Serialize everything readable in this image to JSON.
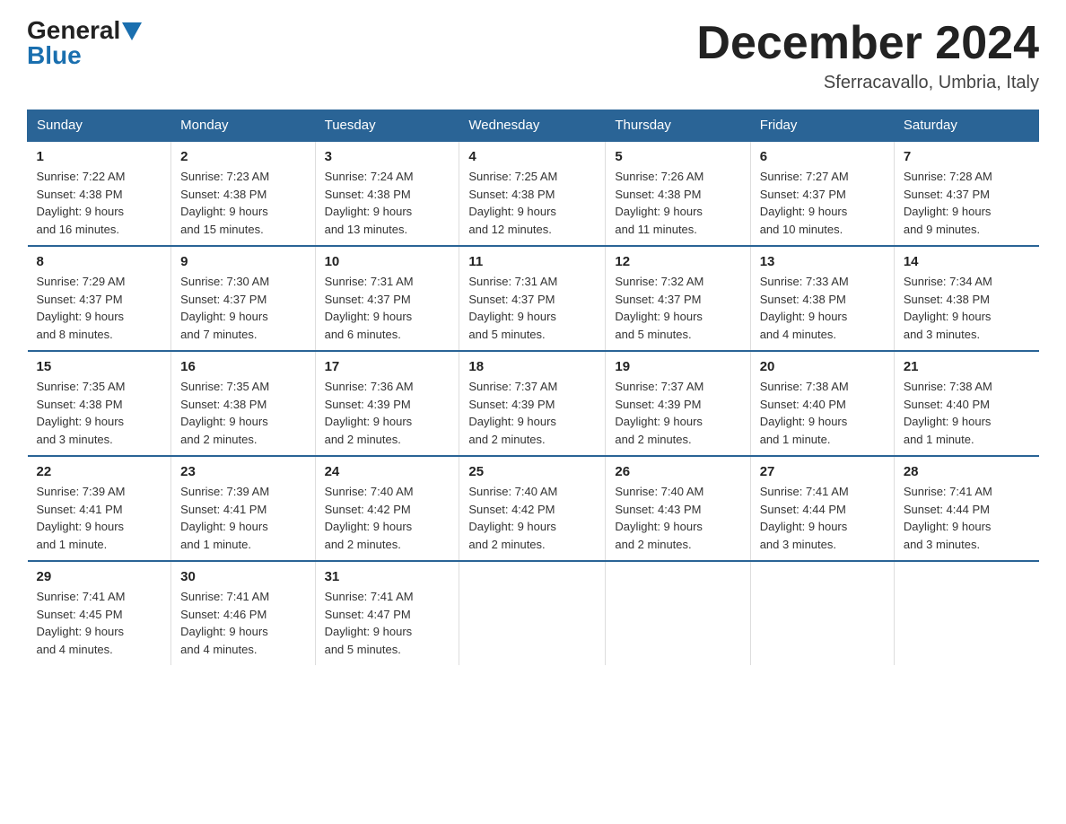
{
  "logo": {
    "general": "General",
    "blue": "Blue"
  },
  "header": {
    "month": "December 2024",
    "location": "Sferracavallo, Umbria, Italy"
  },
  "days_of_week": [
    "Sunday",
    "Monday",
    "Tuesday",
    "Wednesday",
    "Thursday",
    "Friday",
    "Saturday"
  ],
  "weeks": [
    [
      {
        "day": "1",
        "sunrise": "7:22 AM",
        "sunset": "4:38 PM",
        "daylight": "9 hours and 16 minutes."
      },
      {
        "day": "2",
        "sunrise": "7:23 AM",
        "sunset": "4:38 PM",
        "daylight": "9 hours and 15 minutes."
      },
      {
        "day": "3",
        "sunrise": "7:24 AM",
        "sunset": "4:38 PM",
        "daylight": "9 hours and 13 minutes."
      },
      {
        "day": "4",
        "sunrise": "7:25 AM",
        "sunset": "4:38 PM",
        "daylight": "9 hours and 12 minutes."
      },
      {
        "day": "5",
        "sunrise": "7:26 AM",
        "sunset": "4:38 PM",
        "daylight": "9 hours and 11 minutes."
      },
      {
        "day": "6",
        "sunrise": "7:27 AM",
        "sunset": "4:37 PM",
        "daylight": "9 hours and 10 minutes."
      },
      {
        "day": "7",
        "sunrise": "7:28 AM",
        "sunset": "4:37 PM",
        "daylight": "9 hours and 9 minutes."
      }
    ],
    [
      {
        "day": "8",
        "sunrise": "7:29 AM",
        "sunset": "4:37 PM",
        "daylight": "9 hours and 8 minutes."
      },
      {
        "day": "9",
        "sunrise": "7:30 AM",
        "sunset": "4:37 PM",
        "daylight": "9 hours and 7 minutes."
      },
      {
        "day": "10",
        "sunrise": "7:31 AM",
        "sunset": "4:37 PM",
        "daylight": "9 hours and 6 minutes."
      },
      {
        "day": "11",
        "sunrise": "7:31 AM",
        "sunset": "4:37 PM",
        "daylight": "9 hours and 5 minutes."
      },
      {
        "day": "12",
        "sunrise": "7:32 AM",
        "sunset": "4:37 PM",
        "daylight": "9 hours and 5 minutes."
      },
      {
        "day": "13",
        "sunrise": "7:33 AM",
        "sunset": "4:38 PM",
        "daylight": "9 hours and 4 minutes."
      },
      {
        "day": "14",
        "sunrise": "7:34 AM",
        "sunset": "4:38 PM",
        "daylight": "9 hours and 3 minutes."
      }
    ],
    [
      {
        "day": "15",
        "sunrise": "7:35 AM",
        "sunset": "4:38 PM",
        "daylight": "9 hours and 3 minutes."
      },
      {
        "day": "16",
        "sunrise": "7:35 AM",
        "sunset": "4:38 PM",
        "daylight": "9 hours and 2 minutes."
      },
      {
        "day": "17",
        "sunrise": "7:36 AM",
        "sunset": "4:39 PM",
        "daylight": "9 hours and 2 minutes."
      },
      {
        "day": "18",
        "sunrise": "7:37 AM",
        "sunset": "4:39 PM",
        "daylight": "9 hours and 2 minutes."
      },
      {
        "day": "19",
        "sunrise": "7:37 AM",
        "sunset": "4:39 PM",
        "daylight": "9 hours and 2 minutes."
      },
      {
        "day": "20",
        "sunrise": "7:38 AM",
        "sunset": "4:40 PM",
        "daylight": "9 hours and 1 minute."
      },
      {
        "day": "21",
        "sunrise": "7:38 AM",
        "sunset": "4:40 PM",
        "daylight": "9 hours and 1 minute."
      }
    ],
    [
      {
        "day": "22",
        "sunrise": "7:39 AM",
        "sunset": "4:41 PM",
        "daylight": "9 hours and 1 minute."
      },
      {
        "day": "23",
        "sunrise": "7:39 AM",
        "sunset": "4:41 PM",
        "daylight": "9 hours and 1 minute."
      },
      {
        "day": "24",
        "sunrise": "7:40 AM",
        "sunset": "4:42 PM",
        "daylight": "9 hours and 2 minutes."
      },
      {
        "day": "25",
        "sunrise": "7:40 AM",
        "sunset": "4:42 PM",
        "daylight": "9 hours and 2 minutes."
      },
      {
        "day": "26",
        "sunrise": "7:40 AM",
        "sunset": "4:43 PM",
        "daylight": "9 hours and 2 minutes."
      },
      {
        "day": "27",
        "sunrise": "7:41 AM",
        "sunset": "4:44 PM",
        "daylight": "9 hours and 3 minutes."
      },
      {
        "day": "28",
        "sunrise": "7:41 AM",
        "sunset": "4:44 PM",
        "daylight": "9 hours and 3 minutes."
      }
    ],
    [
      {
        "day": "29",
        "sunrise": "7:41 AM",
        "sunset": "4:45 PM",
        "daylight": "9 hours and 4 minutes."
      },
      {
        "day": "30",
        "sunrise": "7:41 AM",
        "sunset": "4:46 PM",
        "daylight": "9 hours and 4 minutes."
      },
      {
        "day": "31",
        "sunrise": "7:41 AM",
        "sunset": "4:47 PM",
        "daylight": "9 hours and 5 minutes."
      },
      null,
      null,
      null,
      null
    ]
  ],
  "labels": {
    "sunrise": "Sunrise:",
    "sunset": "Sunset:",
    "daylight": "Daylight:"
  }
}
